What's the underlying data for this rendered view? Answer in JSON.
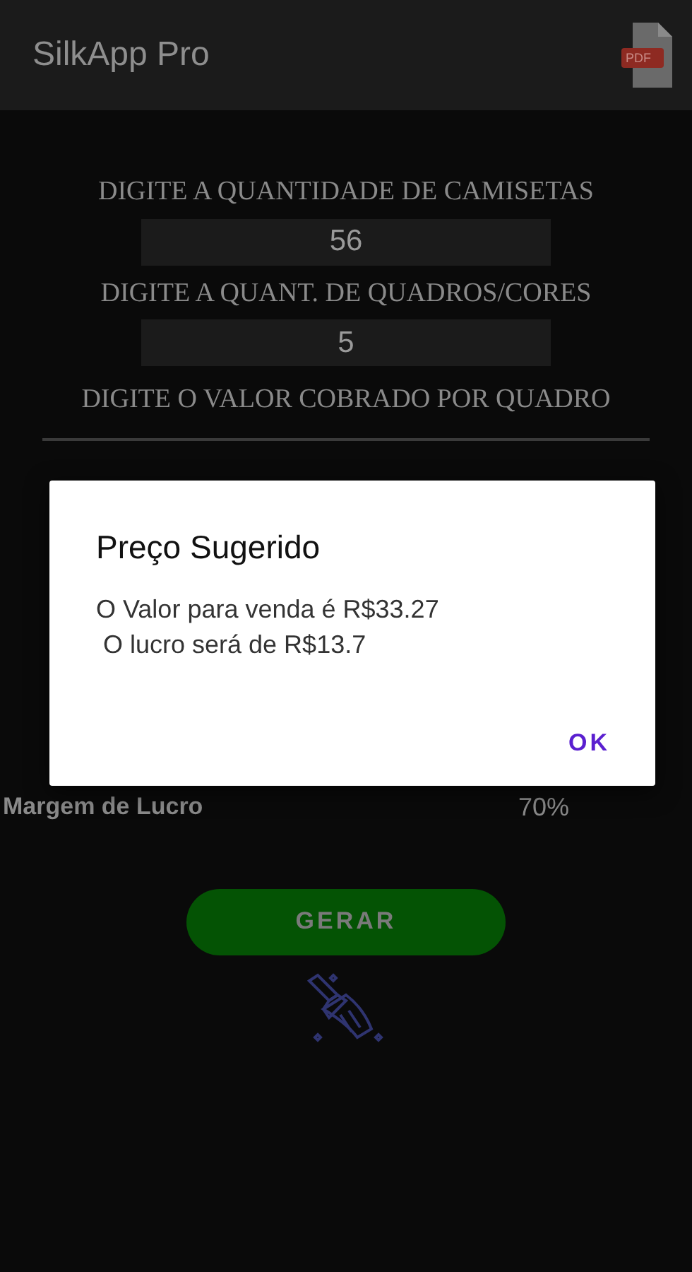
{
  "app_bar": {
    "title": "SilkApp Pro",
    "pdf_label": "PDF"
  },
  "form": [
    {
      "kind": "field",
      "label": "DIGITE A QUANTIDADE DE CAMISETAS",
      "value": "56"
    },
    {
      "kind": "field",
      "label": "DIGITE A QUANT. DE QUADROS/CORES",
      "value": "5"
    },
    {
      "kind": "line",
      "label": "DIGITE O VALOR COBRADO POR QUADRO"
    }
  ],
  "margin": {
    "label": "Margem de Lucro",
    "value": "70%"
  },
  "generate_button": "GERAR",
  "dialog": {
    "title": "Preço Sugerido",
    "lines": [
      "O Valor para venda é R$33.27",
      " O lucro será de R$13.7"
    ],
    "button": "OK"
  }
}
